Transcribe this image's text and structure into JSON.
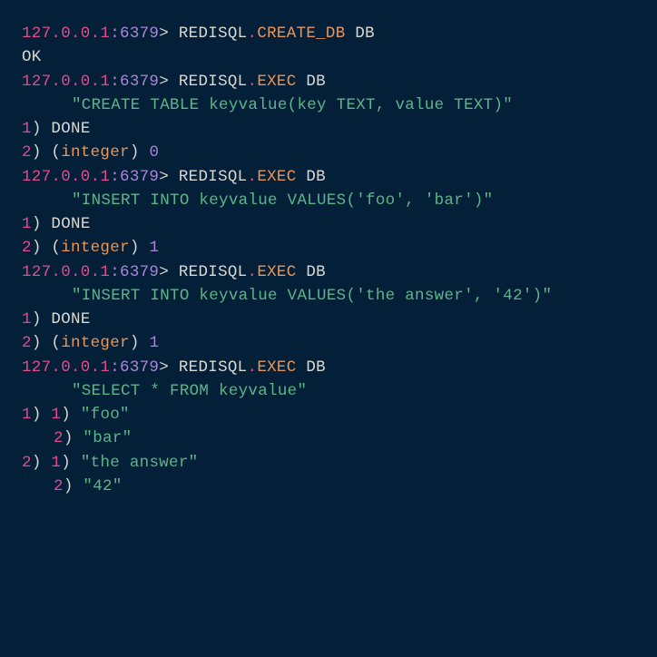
{
  "prompt": {
    "ip": "127.0.0.1",
    "colon": ":",
    "port": "6379",
    "gt": ">"
  },
  "cmd1": {
    "redisql": "REDISQL",
    "dot": ".",
    "sub": "CREATE_DB",
    "arg": "DB"
  },
  "ok": "OK",
  "cmd2": {
    "redisql": "REDISQL",
    "dot": ".",
    "sub": "EXEC",
    "arg": "DB",
    "sql": "\"CREATE TABLE keyvalue(key TEXT, value TEXT)\""
  },
  "res2": {
    "l1n": "1",
    "l1p": ") ",
    "done": "DONE",
    "l2n": "2",
    "l2p": ") (",
    "int": "integer",
    "close": ") ",
    "val": "0"
  },
  "cmd3": {
    "redisql": "REDISQL",
    "dot": ".",
    "sub": "EXEC",
    "arg": "DB",
    "sql": "\"INSERT INTO keyvalue VALUES('foo', 'bar')\""
  },
  "res3": {
    "l1n": "1",
    "l1p": ") ",
    "done": "DONE",
    "l2n": "2",
    "l2p": ") (",
    "int": "integer",
    "close": ") ",
    "val": "1"
  },
  "cmd4": {
    "redisql": "REDISQL",
    "dot": ".",
    "sub": "EXEC",
    "arg": "DB",
    "sql": "\"INSERT INTO keyvalue VALUES('the answer', '42')\""
  },
  "res4": {
    "l1n": "1",
    "l1p": ") ",
    "done": "DONE",
    "l2n": "2",
    "l2p": ") (",
    "int": "integer",
    "close": ") ",
    "val": "1"
  },
  "cmd5": {
    "redisql": "REDISQL",
    "dot": ".",
    "sub": "EXEC",
    "arg": "DB",
    "sql": "\"SELECT * FROM keyvalue\""
  },
  "res5": {
    "r1": {
      "on": "1",
      "in1": "1",
      "in2": "2",
      "v1": "\"foo\"",
      "v2": "\"bar\""
    },
    "r2": {
      "on": "2",
      "in1": "1",
      "in2": "2",
      "v1": "\"the answer\"",
      "v2": "\"42\""
    },
    "p": ") "
  }
}
